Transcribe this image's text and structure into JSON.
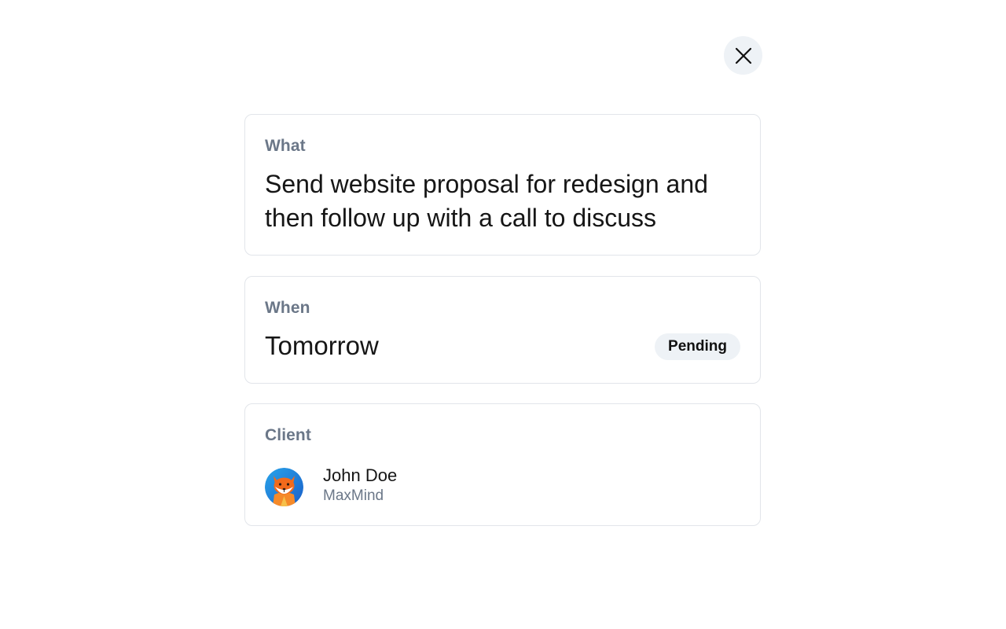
{
  "close": {
    "icon": "close-icon"
  },
  "what": {
    "label": "What",
    "text": "Send website proposal for redesign and then follow up with a call to discuss"
  },
  "when": {
    "label": "When",
    "value": "Tomorrow",
    "status": "Pending"
  },
  "client": {
    "label": "Client",
    "name": "John Doe",
    "company": "MaxMind",
    "avatar_icon": "fox-avatar-icon"
  },
  "colors": {
    "label_gray": "#6b7788",
    "border": "#e2e5ea",
    "badge_bg": "#eef2f6",
    "close_bg": "#eef2f6",
    "avatar_blue": "#1f8fe0",
    "avatar_orange": "#f26a1b"
  }
}
